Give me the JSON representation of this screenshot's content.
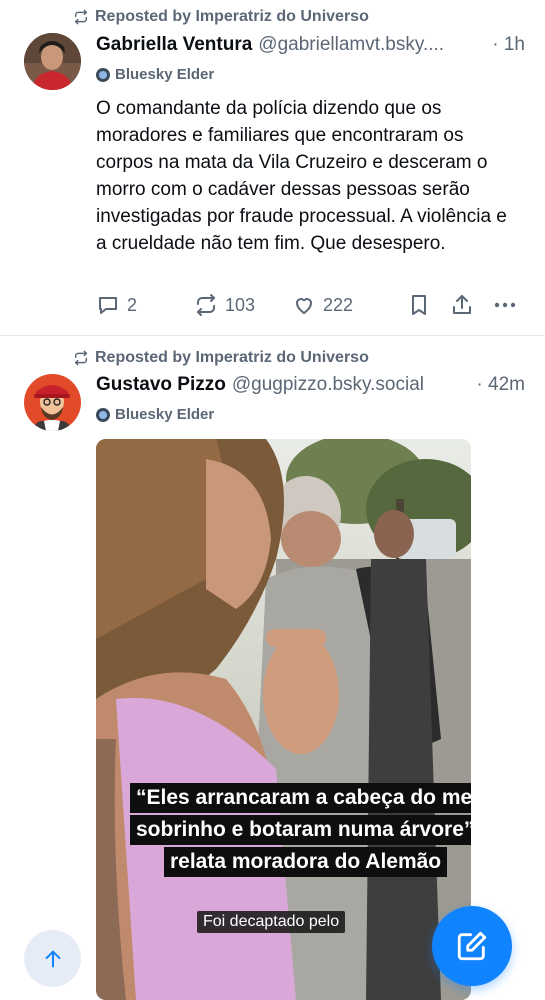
{
  "posts": [
    {
      "repost_label": "Reposted by Imperatriz do Universo",
      "display_name": "Gabriella Ventura",
      "handle": "@gabriellamvt.bsky....",
      "time": "· 1h",
      "badge": "Bluesky Elder",
      "text": "O comandante da polícia dizendo que os moradores e familiares que encontraram os corpos na mata da Vila Cruzeiro e desceram o morro com o cadáver dessas pessoas serão investigadas por fraude processual. A violência e a crueldade não tem fim. Que desespero.",
      "replies": "2",
      "reposts": "103",
      "likes": "222"
    },
    {
      "repost_label": "Reposted by Imperatriz do Universo",
      "display_name": "Gustavo Pizzo",
      "handle": "@gugpizzo.bsky.social",
      "time": "· 42m",
      "badge": "Bluesky Elder",
      "media": {
        "caption_lines": [
          "“Eles arrancaram a cabeça do meu",
          "sobrinho e botaram numa árvore”,",
          "relata moradora do Alemão"
        ],
        "subtitle": "Foi decaptado pelo"
      }
    }
  ],
  "icons": {
    "repost": "repost-icon",
    "reply": "reply-icon",
    "like": "heart-icon",
    "bookmark": "bookmark-icon",
    "share": "share-icon",
    "more": "more-icon",
    "scroll_top": "arrow-up-icon",
    "compose": "compose-icon"
  },
  "colors": {
    "accent": "#1083fe",
    "muted": "#5b6776"
  }
}
